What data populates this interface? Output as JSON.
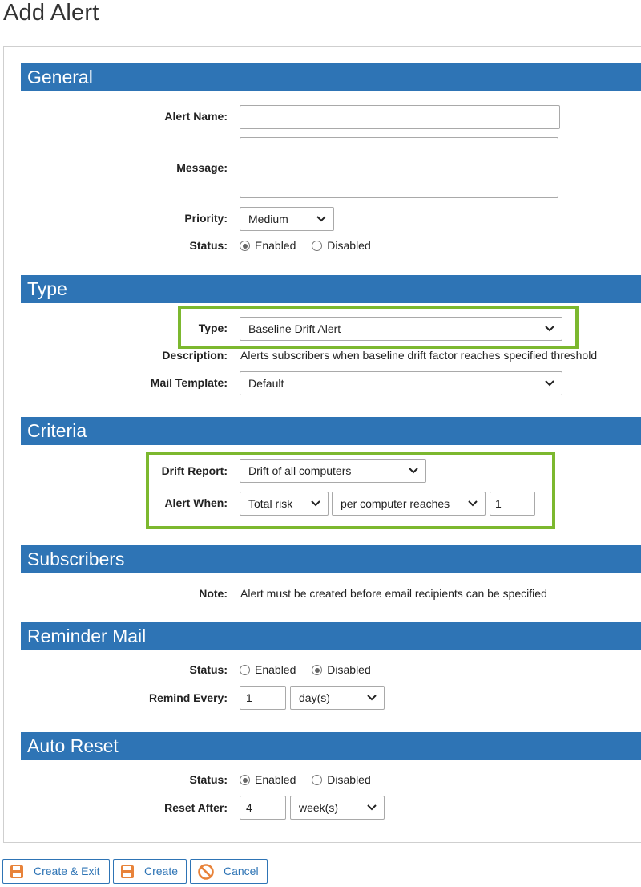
{
  "page_title": "Add Alert",
  "sections": {
    "general": "General",
    "type": "Type",
    "criteria": "Criteria",
    "subscribers": "Subscribers",
    "reminder": "Reminder Mail",
    "auto_reset": "Auto Reset"
  },
  "general": {
    "alert_name_label": "Alert Name:",
    "alert_name_value": "",
    "message_label": "Message:",
    "message_value": "",
    "priority_label": "Priority:",
    "priority_value": "Medium",
    "status_label": "Status:",
    "status_enabled": "Enabled",
    "status_disabled": "Disabled",
    "status_selected": "Enabled"
  },
  "type": {
    "type_label": "Type:",
    "type_value": "Baseline Drift Alert",
    "description_label": "Description:",
    "description_value": "Alerts subscribers when baseline drift factor reaches specified threshold",
    "mail_template_label": "Mail Template:",
    "mail_template_value": "Default"
  },
  "criteria": {
    "drift_report_label": "Drift Report:",
    "drift_report_value": "Drift of all computers",
    "alert_when_label": "Alert When:",
    "alert_when_metric": "Total risk",
    "alert_when_condition": "per computer reaches",
    "alert_when_threshold": "1"
  },
  "subscribers": {
    "note_label": "Note:",
    "note_value": "Alert must be created before email recipients can be specified"
  },
  "reminder": {
    "status_label": "Status:",
    "status_enabled": "Enabled",
    "status_disabled": "Disabled",
    "status_selected": "Disabled",
    "remind_every_label": "Remind Every:",
    "remind_every_value": "1",
    "remind_every_unit": "day(s)"
  },
  "auto_reset": {
    "status_label": "Status:",
    "status_enabled": "Enabled",
    "status_disabled": "Disabled",
    "status_selected": "Enabled",
    "reset_after_label": "Reset After:",
    "reset_after_value": "4",
    "reset_after_unit": "week(s)"
  },
  "buttons": {
    "create_exit": "Create & Exit",
    "create": "Create",
    "cancel": "Cancel"
  },
  "colors": {
    "section_header": "#2e74b5",
    "highlight": "#7cb82f",
    "button_icon": "#e8833a"
  },
  "icons": {
    "save": "floppy-disk-icon",
    "cancel": "prohibited-icon",
    "dropdown": "chevron-down-icon"
  }
}
